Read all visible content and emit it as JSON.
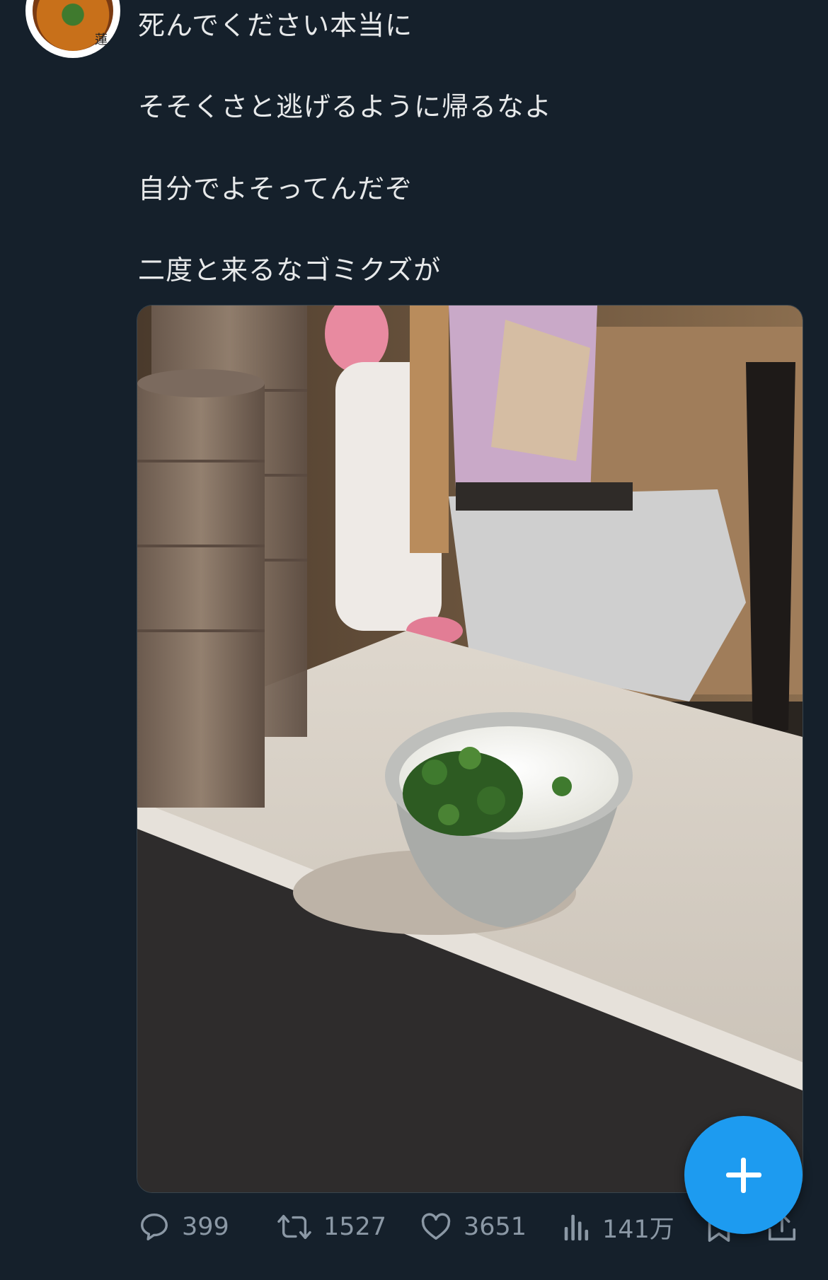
{
  "tweet": {
    "lines": [
      "死んでください本当に",
      "そそくさと逃げるように帰るなよ",
      "自分でよそってんだぞ",
      "二度と来るなゴミクズが"
    ]
  },
  "avatar": {
    "icon": "ramen-bowl-avatar",
    "logo_text": "蓮"
  },
  "media": {
    "subject": "rice-bowl-with-pickles-photo"
  },
  "actions": {
    "reply": {
      "icon": "reply-icon",
      "count": "399"
    },
    "retweet": {
      "icon": "retweet-icon",
      "count": "1527"
    },
    "like": {
      "icon": "heart-icon",
      "count": "3651"
    },
    "views": {
      "icon": "views-icon",
      "count": "141万"
    },
    "bookmark": {
      "icon": "bookmark-icon"
    },
    "share": {
      "icon": "share-icon"
    }
  },
  "compose": {
    "icon": "plus-icon"
  },
  "colors": {
    "background": "#15202b",
    "text": "#e7e9ea",
    "muted": "#8b98a5",
    "accent": "#1d9bf0"
  }
}
